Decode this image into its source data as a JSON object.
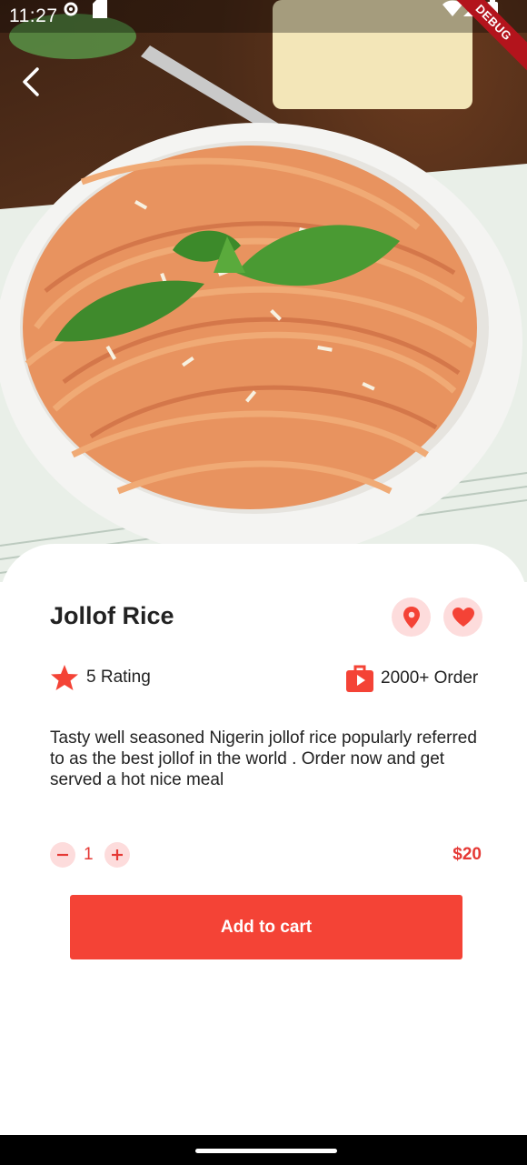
{
  "status": {
    "time": "11:27",
    "debug_label": "DEBUG"
  },
  "product": {
    "title": "Jollof Rice",
    "rating_label": "5 Rating",
    "orders_label": "2000+ Order",
    "description": "Tasty well seasoned Nigerin jollof rice popularly referred to as the best jollof in the world . Order now and get served a hot nice meal",
    "quantity": "1",
    "price": "$20"
  },
  "actions": {
    "add_to_cart": "Add to cart"
  },
  "icons": {
    "back": "chevron-left-icon",
    "location": "location-pin-icon",
    "favorite": "heart-icon",
    "rating": "star-icon",
    "orders": "shopping-bag-icon",
    "decrease": "minus-icon",
    "increase": "plus-icon"
  },
  "colors": {
    "accent": "#f44336",
    "accent_soft": "#fddcdc",
    "text": "#222222"
  }
}
